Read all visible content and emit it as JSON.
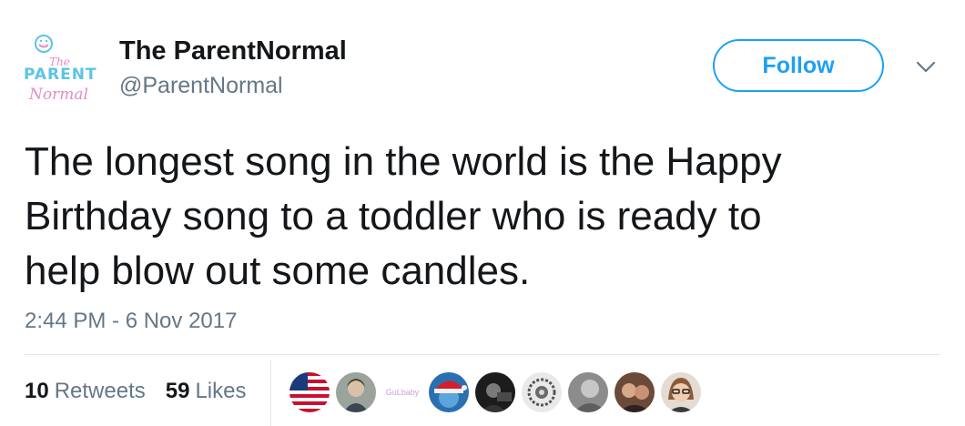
{
  "user": {
    "display_name": "The ParentNormal",
    "handle": "@ParentNormal",
    "avatar_logo": {
      "line1": "The",
      "line2": "PARENT",
      "line3": "Normal"
    }
  },
  "actions": {
    "follow_label": "Follow",
    "menu_icon": "chevron-down-icon"
  },
  "tweet": {
    "lines": [
      "The longest song in the world is the Happy",
      "Birthday song to a toddler who is ready to",
      "help blow out some candles."
    ],
    "timestamp": "2:44 PM - 6 Nov 2017"
  },
  "stats": {
    "retweets_count": "10",
    "retweets_label": "Retweets",
    "likes_count": "59",
    "likes_label": "Likes"
  },
  "likers": [
    {
      "icon": "us-flag-avatar"
    },
    {
      "icon": "user-avatar"
    },
    {
      "icon": "text-avatar",
      "text": "GuLbaby"
    },
    {
      "icon": "santa-hat-avatar"
    },
    {
      "icon": "user-avatar"
    },
    {
      "icon": "user-avatar"
    },
    {
      "icon": "user-avatar"
    },
    {
      "icon": "user-avatar"
    },
    {
      "icon": "user-avatar"
    }
  ],
  "colors": {
    "accent": "#1da1f2",
    "text": "#14171a",
    "muted": "#657786",
    "border": "#e1e8ed",
    "logo_pink": "#e58bc4",
    "logo_blue": "#5bc4e8"
  }
}
